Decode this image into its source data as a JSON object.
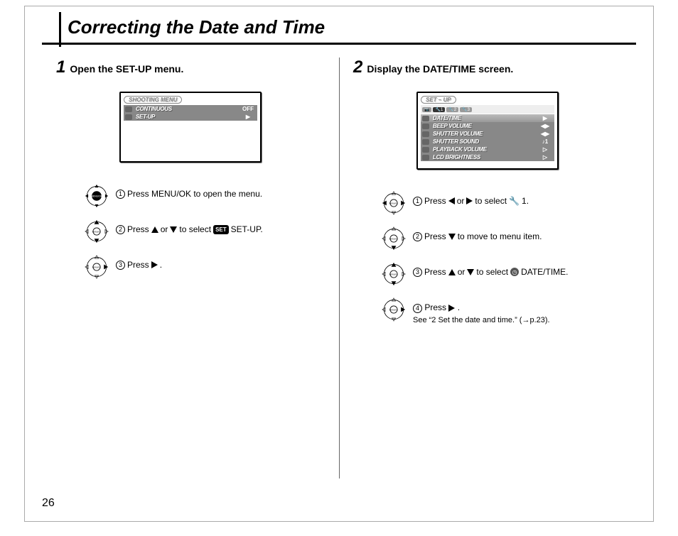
{
  "page_number": "26",
  "title": "Correcting the Date and Time",
  "left": {
    "step_num": "1",
    "step_title": "Open the SET-UP menu.",
    "lcd": {
      "header": "SHOOTING MENU",
      "rows": [
        {
          "label": "CONTINUOUS",
          "value": "OFF"
        },
        {
          "label": "SET-UP",
          "value": "▶"
        }
      ]
    },
    "instructions": [
      {
        "n": "1",
        "pre": "Press MENU/OK to open the menu."
      },
      {
        "n": "2",
        "parts": [
          "Press ",
          "▲",
          " or ",
          "▼",
          " to select ",
          "SET",
          " SET-UP."
        ]
      },
      {
        "n": "3",
        "parts": [
          "Press ",
          "▶",
          "."
        ]
      }
    ]
  },
  "right": {
    "step_num": "2",
    "step_title": "Display the DATE/TIME screen.",
    "lcd": {
      "header": "SET – UP",
      "tabs": [
        "📷",
        "🔧1",
        "🔧2",
        "🔧3"
      ],
      "rows": [
        {
          "label": "DATE/TIME",
          "value": "▶",
          "hl": true
        },
        {
          "label": "BEEP VOLUME",
          "value": "◀▶"
        },
        {
          "label": "SHUTTER VOLUME",
          "value": "◀▶"
        },
        {
          "label": "SHUTTER SOUND",
          "value": "♪1"
        },
        {
          "label": "PLAYBACK VOLUME",
          "value": "▷"
        },
        {
          "label": "LCD BRIGHTNESS",
          "value": "▷"
        }
      ]
    },
    "instructions": [
      {
        "n": "1",
        "parts": [
          "Press ",
          "◀",
          " or ",
          "▶",
          " to select ",
          "🔧",
          "1."
        ]
      },
      {
        "n": "2",
        "parts": [
          "Press ",
          "▼",
          " to move to menu item."
        ]
      },
      {
        "n": "3",
        "parts": [
          "Press ",
          "▲",
          " or ",
          "▼",
          " to select ",
          "⏲",
          " DATE/TIME."
        ]
      },
      {
        "n": "4",
        "parts": [
          "Press ",
          "▶",
          "."
        ],
        "sub": "See “2 Set the date and time.” (→p.23)."
      }
    ]
  }
}
